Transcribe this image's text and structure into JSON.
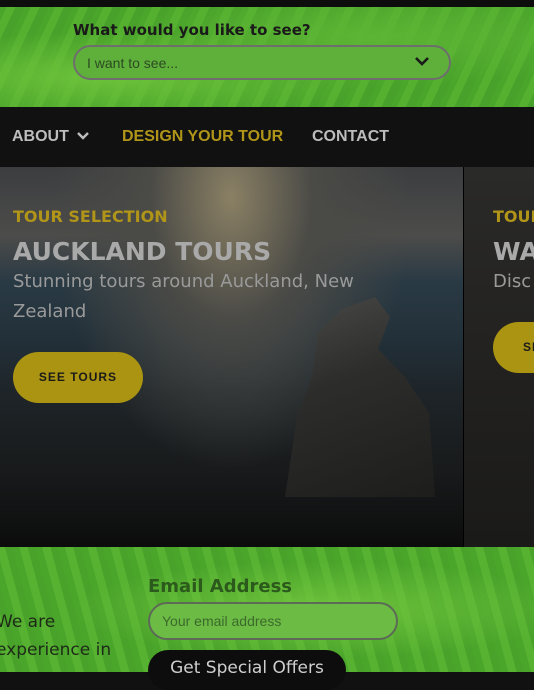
{
  "search": {
    "label": "What would you like to see?",
    "placeholder": "I want to see..."
  },
  "nav": {
    "about": "ABOUT",
    "design": "DESIGN YOUR TOUR",
    "contact": "CONTACT"
  },
  "hero": {
    "slide1": {
      "kicker": "TOUR SELECTION",
      "title": "AUCKLAND TOURS",
      "subtitle_line1": "Stunning tours around Auckland, New",
      "subtitle_line2": "Zealand",
      "button": "SEE TOURS"
    },
    "slide2": {
      "kicker": "TOUR SELECTION",
      "title": "WA",
      "subtitle": "Disc",
      "button": "SEE TOURS"
    }
  },
  "footer": {
    "about_line1": "We are",
    "about_line2": "experience in",
    "email_label": "Email Address",
    "email_placeholder": "Your email address",
    "offer_button": "Get Special Offers"
  },
  "colors": {
    "accent": "#b09519",
    "nav_bg": "#111111",
    "band_green": "#4aa52b"
  }
}
